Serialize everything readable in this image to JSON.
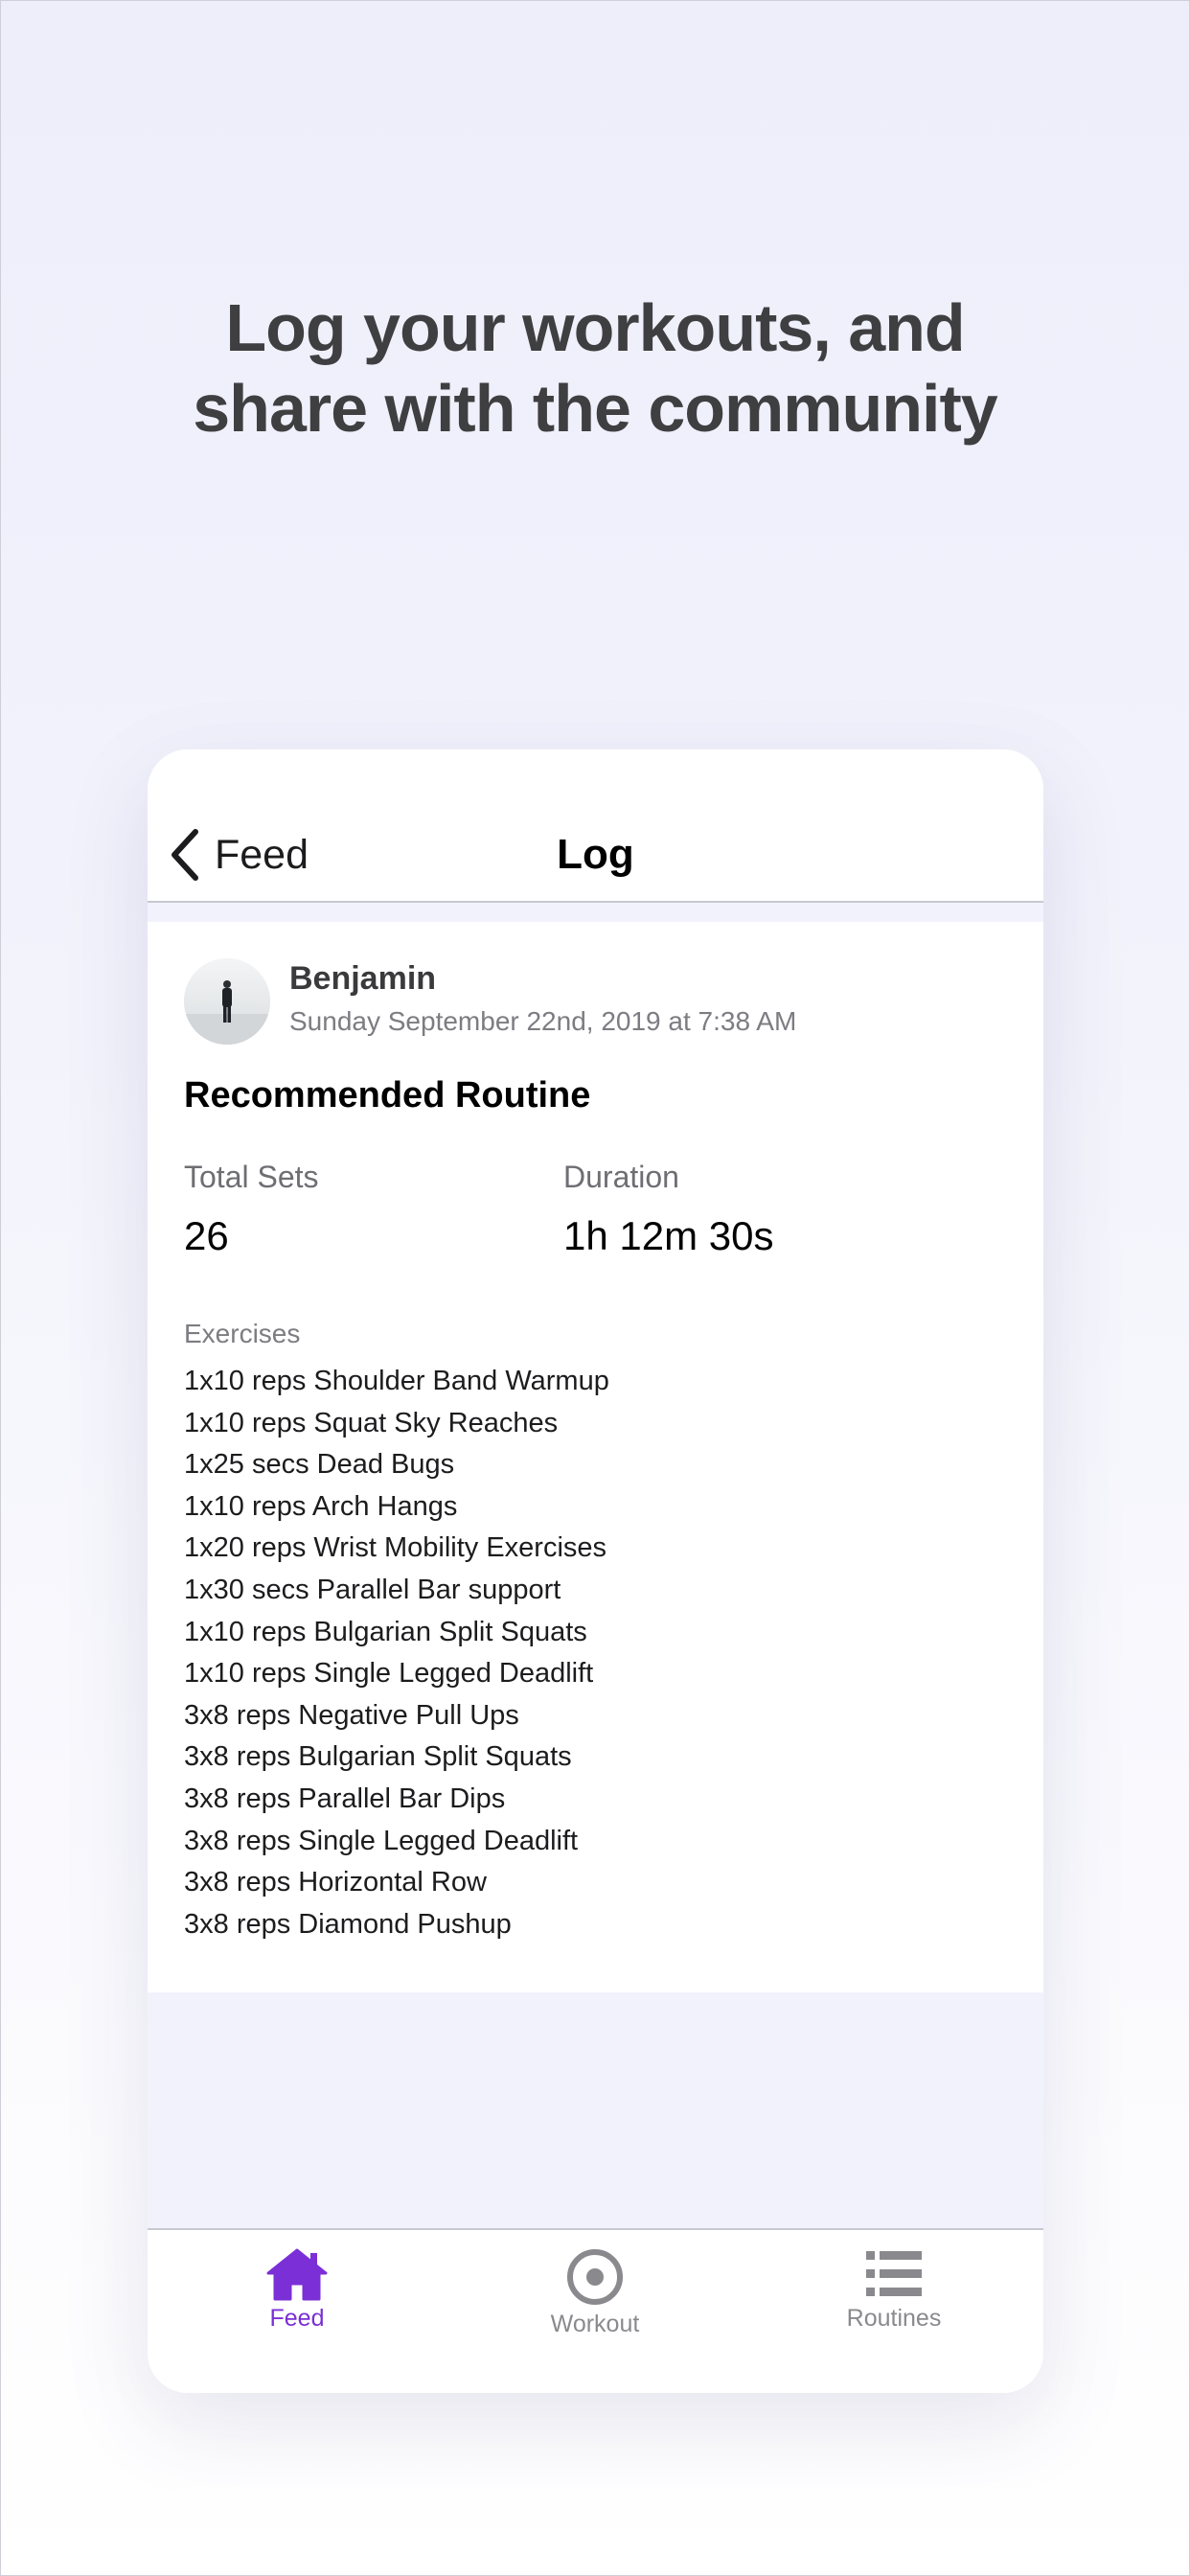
{
  "headline": {
    "line1": "Log your workouts, and",
    "line2": "share with the community"
  },
  "navbar": {
    "back_label": "Feed",
    "title": "Log"
  },
  "post": {
    "user_name": "Benjamin",
    "date": "Sunday September 22nd, 2019 at 7:38 AM",
    "routine_title": "Recommended Routine",
    "stats": {
      "total_sets_label": "Total Sets",
      "total_sets_value": "26",
      "duration_label": "Duration",
      "duration_value": "1h 12m 30s"
    },
    "exercises_label": "Exercises",
    "exercises": [
      "1x10 reps Shoulder Band Warmup",
      "1x10 reps Squat Sky Reaches",
      "1x25 secs Dead Bugs",
      "1x10 reps Arch Hangs",
      "1x20 reps Wrist Mobility Exercises",
      "1x30 secs Parallel Bar support",
      "1x10 reps Bulgarian Split Squats",
      "1x10 reps Single Legged Deadlift",
      "3x8 reps Negative Pull Ups",
      "3x8 reps Bulgarian Split Squats",
      "3x8 reps Parallel Bar Dips",
      "3x8 reps Single Legged Deadlift",
      "3x8 reps Horizontal Row",
      "3x8 reps Diamond Pushup"
    ]
  },
  "tabbar": {
    "tabs": [
      {
        "label": "Feed",
        "icon": "home-icon",
        "active": true
      },
      {
        "label": "Workout",
        "icon": "record-icon",
        "active": false
      },
      {
        "label": "Routines",
        "icon": "list-icon",
        "active": false
      }
    ]
  },
  "colors": {
    "accent": "#7b2fd6",
    "inactive": "#8a8a8e",
    "headline": "#3f3f42",
    "background_tint": "#f2f2fc"
  }
}
